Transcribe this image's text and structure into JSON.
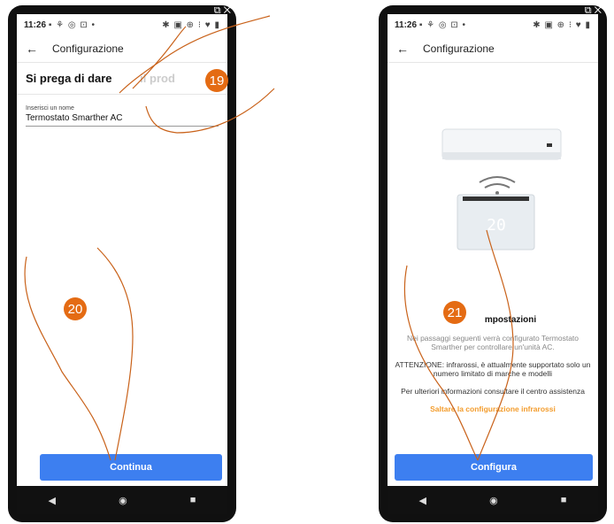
{
  "left": {
    "status_time": "11:26",
    "status_icons": "▪ ⚘ ◎ ⊡ •",
    "status_right": "✱ ▣ ⊕ ⁝ ♥ ▮",
    "title": "Configurazione",
    "heading_a": "Si prega di dare",
    "heading_b": "il prod",
    "field_label": "Inserisci un nome",
    "field_value": "Termostato Smarther AC",
    "step_a": "19",
    "step_b": "20",
    "button": "Continua"
  },
  "right": {
    "status_time": "11:26",
    "status_icons": "▪ ⚘ ◎ ⊡ •",
    "status_right": "✱ ▣ ⊕ ⁝ ♥ ▮",
    "title": "Configurazione",
    "step": "21",
    "display": "20",
    "settings_title": "mpostazioni",
    "para1": "Nei passaggi seguenti verrà configurato Termostato Smarther per controllare un'unità AC.",
    "para2": "ATTENZIONE: infrarossi, è attualmente supportato solo un numero limitato di marche e modelli",
    "para3": "Per ulteriori informazioni consultare il centro assistenza",
    "link": "Saltare la configurazione infrarossi",
    "button": "Configura"
  },
  "nav": {
    "back": "◀",
    "home": "◉",
    "recent": "■"
  },
  "colors": {
    "accent": "#3d7ff0",
    "step": "#e46b13",
    "link": "#f39c2c"
  }
}
